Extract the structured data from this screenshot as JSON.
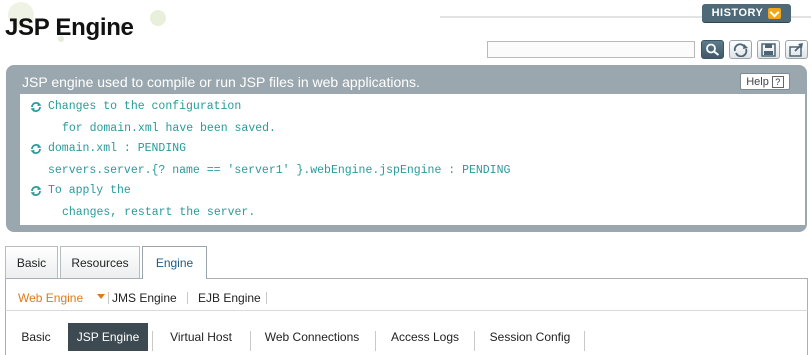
{
  "page": {
    "title": "JSP Engine"
  },
  "header": {
    "history_label": "HISTORY"
  },
  "toolbar": {
    "search_value": "",
    "icons": [
      "search-icon",
      "refresh-icon",
      "save-icon",
      "export-icon"
    ]
  },
  "description": {
    "text": "JSP engine used to compile or run JSP files in web applications.",
    "help_label": "Help",
    "help_glyph": "?",
    "messages": [
      {
        "icon": "sync-icon",
        "line": "Changes to the configuration"
      },
      {
        "icon": "",
        "line": "for domain.xml have been saved."
      },
      {
        "icon": "sync-icon",
        "line": "domain.xml : PENDING"
      },
      {
        "icon": "",
        "line": "servers.server.{? name == 'server1' }.webEngine.jspEngine : PENDING"
      },
      {
        "icon": "sync-icon",
        "line": "To apply the"
      },
      {
        "icon": "",
        "line": "changes, restart the server."
      }
    ]
  },
  "main_tabs": [
    "Basic",
    "Resources",
    "Engine"
  ],
  "main_tabs_active": "Engine",
  "sub_tabs": [
    "Web Engine",
    "JMS Engine",
    "EJB Engine"
  ],
  "sub_tabs_active": "Web Engine",
  "engine_tabs": [
    "Basic",
    "JSP Engine",
    "Virtual Host",
    "Web Connections",
    "Access Logs",
    "Session Config"
  ],
  "engine_tabs_active": "JSP Engine",
  "colors": {
    "accent": "#e07a1a",
    "panel": "#9aa7af",
    "message": "#2a9a9a",
    "active_tab": "#3e4a52"
  }
}
